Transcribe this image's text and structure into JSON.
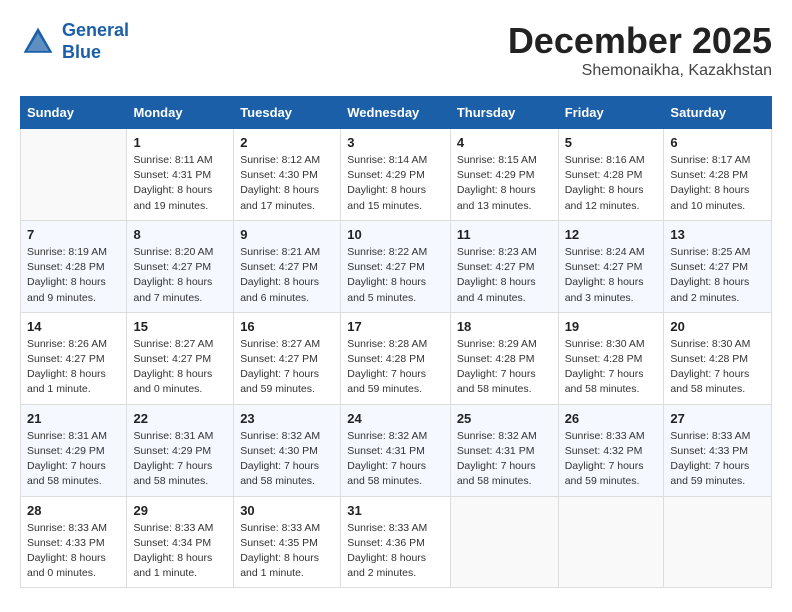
{
  "header": {
    "logo_line1": "General",
    "logo_line2": "Blue",
    "month": "December 2025",
    "location": "Shemonaikha, Kazakhstan"
  },
  "weekdays": [
    "Sunday",
    "Monday",
    "Tuesday",
    "Wednesday",
    "Thursday",
    "Friday",
    "Saturday"
  ],
  "weeks": [
    [
      {
        "day": "",
        "sunrise": "",
        "sunset": "",
        "daylight": ""
      },
      {
        "day": "1",
        "sunrise": "Sunrise: 8:11 AM",
        "sunset": "Sunset: 4:31 PM",
        "daylight": "Daylight: 8 hours and 19 minutes."
      },
      {
        "day": "2",
        "sunrise": "Sunrise: 8:12 AM",
        "sunset": "Sunset: 4:30 PM",
        "daylight": "Daylight: 8 hours and 17 minutes."
      },
      {
        "day": "3",
        "sunrise": "Sunrise: 8:14 AM",
        "sunset": "Sunset: 4:29 PM",
        "daylight": "Daylight: 8 hours and 15 minutes."
      },
      {
        "day": "4",
        "sunrise": "Sunrise: 8:15 AM",
        "sunset": "Sunset: 4:29 PM",
        "daylight": "Daylight: 8 hours and 13 minutes."
      },
      {
        "day": "5",
        "sunrise": "Sunrise: 8:16 AM",
        "sunset": "Sunset: 4:28 PM",
        "daylight": "Daylight: 8 hours and 12 minutes."
      },
      {
        "day": "6",
        "sunrise": "Sunrise: 8:17 AM",
        "sunset": "Sunset: 4:28 PM",
        "daylight": "Daylight: 8 hours and 10 minutes."
      }
    ],
    [
      {
        "day": "7",
        "sunrise": "Sunrise: 8:19 AM",
        "sunset": "Sunset: 4:28 PM",
        "daylight": "Daylight: 8 hours and 9 minutes."
      },
      {
        "day": "8",
        "sunrise": "Sunrise: 8:20 AM",
        "sunset": "Sunset: 4:27 PM",
        "daylight": "Daylight: 8 hours and 7 minutes."
      },
      {
        "day": "9",
        "sunrise": "Sunrise: 8:21 AM",
        "sunset": "Sunset: 4:27 PM",
        "daylight": "Daylight: 8 hours and 6 minutes."
      },
      {
        "day": "10",
        "sunrise": "Sunrise: 8:22 AM",
        "sunset": "Sunset: 4:27 PM",
        "daylight": "Daylight: 8 hours and 5 minutes."
      },
      {
        "day": "11",
        "sunrise": "Sunrise: 8:23 AM",
        "sunset": "Sunset: 4:27 PM",
        "daylight": "Daylight: 8 hours and 4 minutes."
      },
      {
        "day": "12",
        "sunrise": "Sunrise: 8:24 AM",
        "sunset": "Sunset: 4:27 PM",
        "daylight": "Daylight: 8 hours and 3 minutes."
      },
      {
        "day": "13",
        "sunrise": "Sunrise: 8:25 AM",
        "sunset": "Sunset: 4:27 PM",
        "daylight": "Daylight: 8 hours and 2 minutes."
      }
    ],
    [
      {
        "day": "14",
        "sunrise": "Sunrise: 8:26 AM",
        "sunset": "Sunset: 4:27 PM",
        "daylight": "Daylight: 8 hours and 1 minute."
      },
      {
        "day": "15",
        "sunrise": "Sunrise: 8:27 AM",
        "sunset": "Sunset: 4:27 PM",
        "daylight": "Daylight: 8 hours and 0 minutes."
      },
      {
        "day": "16",
        "sunrise": "Sunrise: 8:27 AM",
        "sunset": "Sunset: 4:27 PM",
        "daylight": "Daylight: 7 hours and 59 minutes."
      },
      {
        "day": "17",
        "sunrise": "Sunrise: 8:28 AM",
        "sunset": "Sunset: 4:28 PM",
        "daylight": "Daylight: 7 hours and 59 minutes."
      },
      {
        "day": "18",
        "sunrise": "Sunrise: 8:29 AM",
        "sunset": "Sunset: 4:28 PM",
        "daylight": "Daylight: 7 hours and 58 minutes."
      },
      {
        "day": "19",
        "sunrise": "Sunrise: 8:30 AM",
        "sunset": "Sunset: 4:28 PM",
        "daylight": "Daylight: 7 hours and 58 minutes."
      },
      {
        "day": "20",
        "sunrise": "Sunrise: 8:30 AM",
        "sunset": "Sunset: 4:28 PM",
        "daylight": "Daylight: 7 hours and 58 minutes."
      }
    ],
    [
      {
        "day": "21",
        "sunrise": "Sunrise: 8:31 AM",
        "sunset": "Sunset: 4:29 PM",
        "daylight": "Daylight: 7 hours and 58 minutes."
      },
      {
        "day": "22",
        "sunrise": "Sunrise: 8:31 AM",
        "sunset": "Sunset: 4:29 PM",
        "daylight": "Daylight: 7 hours and 58 minutes."
      },
      {
        "day": "23",
        "sunrise": "Sunrise: 8:32 AM",
        "sunset": "Sunset: 4:30 PM",
        "daylight": "Daylight: 7 hours and 58 minutes."
      },
      {
        "day": "24",
        "sunrise": "Sunrise: 8:32 AM",
        "sunset": "Sunset: 4:31 PM",
        "daylight": "Daylight: 7 hours and 58 minutes."
      },
      {
        "day": "25",
        "sunrise": "Sunrise: 8:32 AM",
        "sunset": "Sunset: 4:31 PM",
        "daylight": "Daylight: 7 hours and 58 minutes."
      },
      {
        "day": "26",
        "sunrise": "Sunrise: 8:33 AM",
        "sunset": "Sunset: 4:32 PM",
        "daylight": "Daylight: 7 hours and 59 minutes."
      },
      {
        "day": "27",
        "sunrise": "Sunrise: 8:33 AM",
        "sunset": "Sunset: 4:33 PM",
        "daylight": "Daylight: 7 hours and 59 minutes."
      }
    ],
    [
      {
        "day": "28",
        "sunrise": "Sunrise: 8:33 AM",
        "sunset": "Sunset: 4:33 PM",
        "daylight": "Daylight: 8 hours and 0 minutes."
      },
      {
        "day": "29",
        "sunrise": "Sunrise: 8:33 AM",
        "sunset": "Sunset: 4:34 PM",
        "daylight": "Daylight: 8 hours and 1 minute."
      },
      {
        "day": "30",
        "sunrise": "Sunrise: 8:33 AM",
        "sunset": "Sunset: 4:35 PM",
        "daylight": "Daylight: 8 hours and 1 minute."
      },
      {
        "day": "31",
        "sunrise": "Sunrise: 8:33 AM",
        "sunset": "Sunset: 4:36 PM",
        "daylight": "Daylight: 8 hours and 2 minutes."
      },
      {
        "day": "",
        "sunrise": "",
        "sunset": "",
        "daylight": ""
      },
      {
        "day": "",
        "sunrise": "",
        "sunset": "",
        "daylight": ""
      },
      {
        "day": "",
        "sunrise": "",
        "sunset": "",
        "daylight": ""
      }
    ]
  ]
}
